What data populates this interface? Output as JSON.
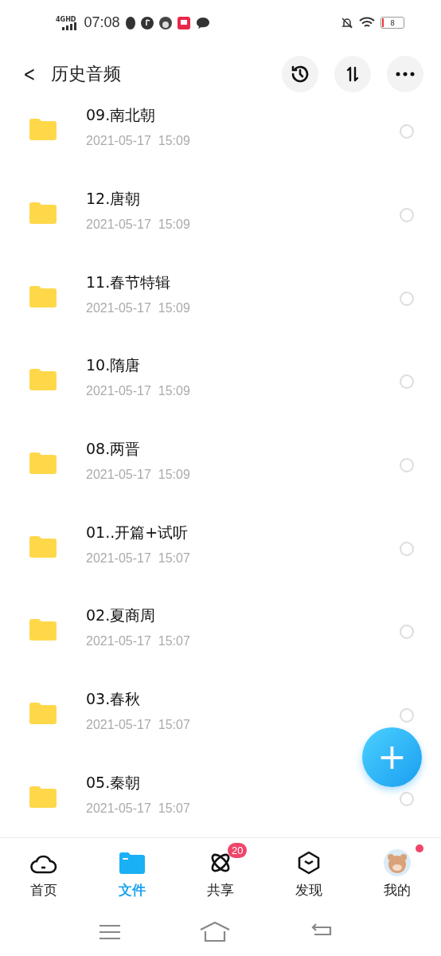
{
  "status_bar": {
    "network": "4GHD",
    "time": "07:08",
    "battery": "8"
  },
  "header": {
    "back": "<",
    "title": "历史音频"
  },
  "files": [
    {
      "name": "09.南北朝",
      "date": "2021-05-17  15:09",
      "selected": false
    },
    {
      "name": "12.唐朝",
      "date": "2021-05-17  15:09",
      "selected": false
    },
    {
      "name": "11.春节特辑",
      "date": "2021-05-17  15:09",
      "selected": false
    },
    {
      "name": "10.隋唐",
      "date": "2021-05-17  15:09",
      "selected": false
    },
    {
      "name": "08.两晋",
      "date": "2021-05-17  15:09",
      "selected": false
    },
    {
      "name": "01..开篇+试听",
      "date": "2021-05-17  15:07",
      "selected": false
    },
    {
      "name": "02.夏商周",
      "date": "2021-05-17  15:07",
      "selected": false
    },
    {
      "name": "03.春秋",
      "date": "2021-05-17  15:07",
      "selected": false
    },
    {
      "name": "05.秦朝",
      "date": "2021-05-17  15:07",
      "selected": false
    }
  ],
  "fab": "+",
  "tabs": [
    {
      "kind": "home",
      "label": "首页",
      "selected": false
    },
    {
      "kind": "files",
      "label": "文件",
      "selected": true
    },
    {
      "kind": "share",
      "label": "共享",
      "selected": false,
      "badge": "20"
    },
    {
      "kind": "discover",
      "label": "发现",
      "selected": false
    },
    {
      "kind": "me",
      "label": "我的",
      "selected": false,
      "dot": true
    }
  ]
}
